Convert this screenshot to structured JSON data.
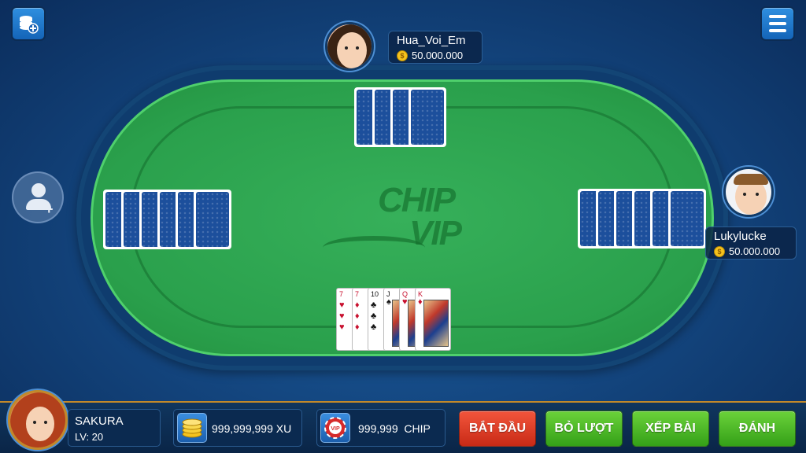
{
  "top_left": {
    "icon": "coins-plus-icon"
  },
  "top_right": {
    "icon": "hamburger-menu-icon"
  },
  "table": {
    "logo_line1": "CHIP",
    "logo_line2": "VIP"
  },
  "players": {
    "top": {
      "name": "Hua_Voi_Em",
      "balance": "50.000.000",
      "cards_back": 4
    },
    "right": {
      "name": "Lukylucke",
      "balance": "50.000.000",
      "cards_back": 6
    },
    "left": {
      "cards_back": 6,
      "seat": "add-player"
    }
  },
  "my_hand": [
    {
      "rank": "7",
      "suit": "♥",
      "color": "red"
    },
    {
      "rank": "7",
      "suit": "♦",
      "color": "red"
    },
    {
      "rank": "10",
      "suit": "♣",
      "color": "black"
    },
    {
      "rank": "J",
      "suit": "♠",
      "color": "black"
    },
    {
      "rank": "Q",
      "suit": "♥",
      "color": "red"
    },
    {
      "rank": "K",
      "suit": "♦",
      "color": "red"
    }
  ],
  "me": {
    "name": "SAKURA",
    "level": "LV: 20"
  },
  "wallet": {
    "xu": "999,999,999 XU",
    "chip": "999,999  CHIP",
    "chip_badge": "VIP"
  },
  "actions": {
    "start": "BẮT ĐẦU",
    "pass": "BỎ LƯỢT",
    "arrange": "XẾP BÀI",
    "play": "ĐÁNH"
  },
  "colors": {
    "felt": "#2aa04c",
    "background": "#154a85",
    "card_back": "#1c4f9c",
    "btn_red": "#d8341f",
    "btn_green": "#4cb825"
  }
}
